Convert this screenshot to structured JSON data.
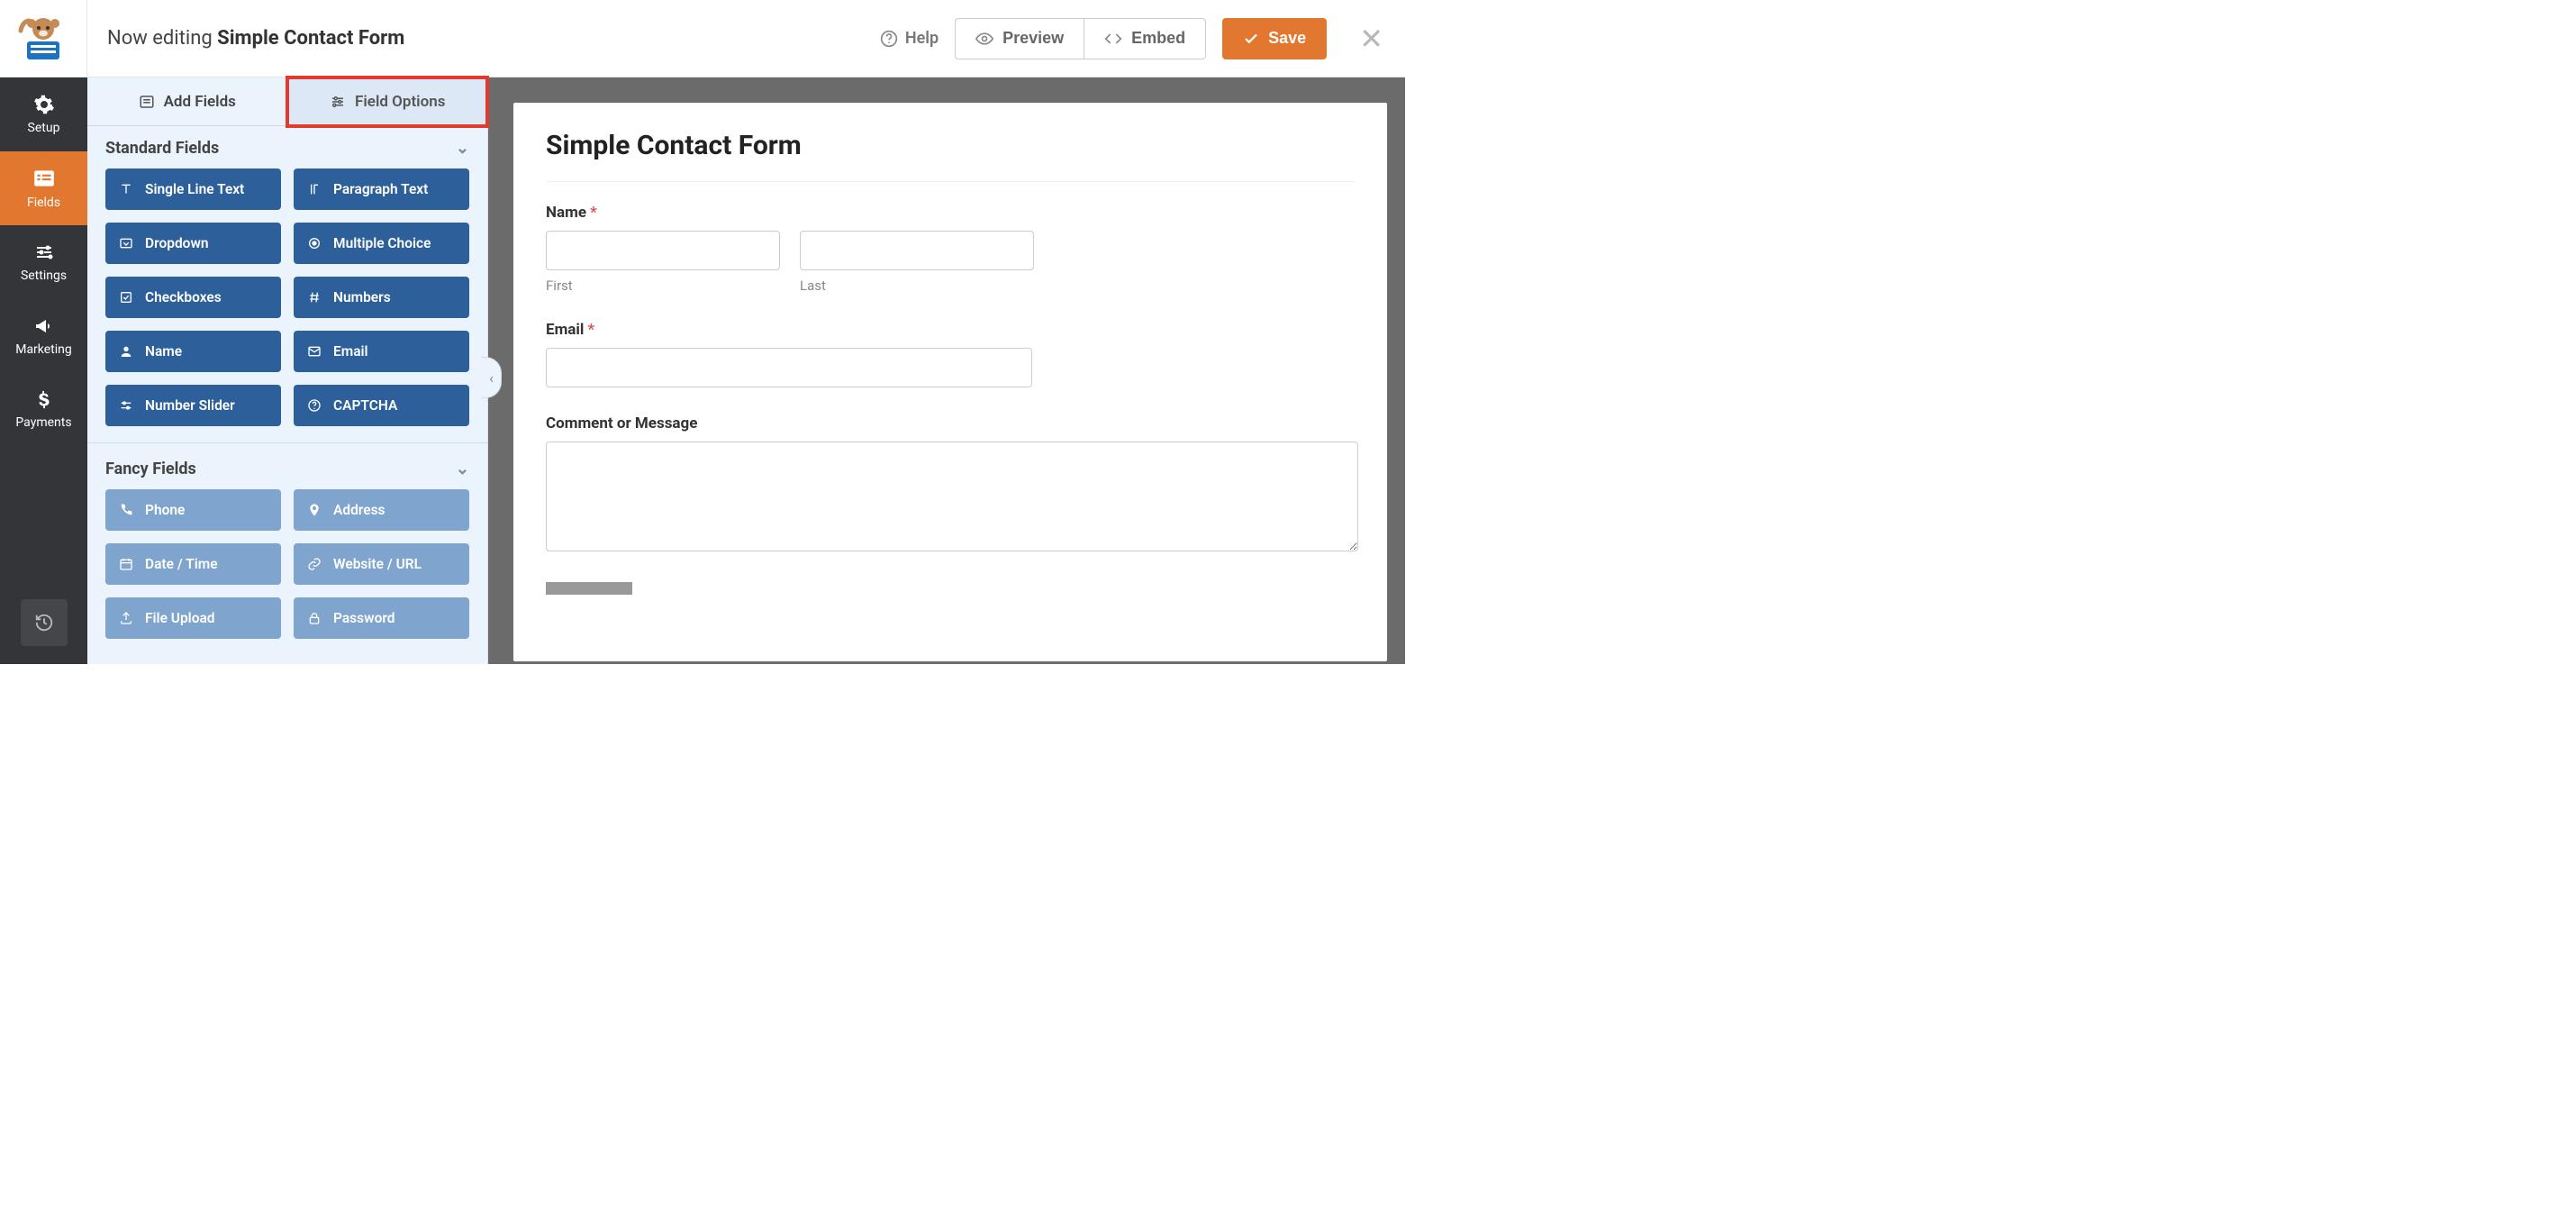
{
  "header": {
    "editing_prefix": "Now editing ",
    "form_name": "Simple Contact Form",
    "help": "Help",
    "preview": "Preview",
    "embed": "Embed",
    "save": "Save"
  },
  "rail": {
    "setup": "Setup",
    "fields": "Fields",
    "settings": "Settings",
    "marketing": "Marketing",
    "payments": "Payments"
  },
  "panel_tabs": {
    "add_fields": "Add Fields",
    "field_options": "Field Options"
  },
  "sections": {
    "standard": "Standard Fields",
    "fancy": "Fancy Fields"
  },
  "standard_fields": [
    {
      "icon": "text-icon",
      "label": "Single Line Text"
    },
    {
      "icon": "paragraph-icon",
      "label": "Paragraph Text"
    },
    {
      "icon": "dropdown-icon",
      "label": "Dropdown"
    },
    {
      "icon": "radio-icon",
      "label": "Multiple Choice"
    },
    {
      "icon": "check-icon",
      "label": "Checkboxes"
    },
    {
      "icon": "hash-icon",
      "label": "Numbers"
    },
    {
      "icon": "user-icon",
      "label": "Name"
    },
    {
      "icon": "mail-icon",
      "label": "Email"
    },
    {
      "icon": "sliders-icon",
      "label": "Number Slider"
    },
    {
      "icon": "help-icon",
      "label": "CAPTCHA"
    }
  ],
  "fancy_fields": [
    {
      "icon": "phone-icon",
      "label": "Phone"
    },
    {
      "icon": "pin-icon",
      "label": "Address"
    },
    {
      "icon": "calendar-icon",
      "label": "Date / Time"
    },
    {
      "icon": "link-icon",
      "label": "Website / URL"
    },
    {
      "icon": "upload-icon",
      "label": "File Upload"
    },
    {
      "icon": "lock-icon",
      "label": "Password"
    }
  ],
  "form": {
    "title": "Simple Contact Form",
    "name_label": "Name",
    "first_sub": "First",
    "last_sub": "Last",
    "email_label": "Email",
    "comment_label": "Comment or Message"
  }
}
